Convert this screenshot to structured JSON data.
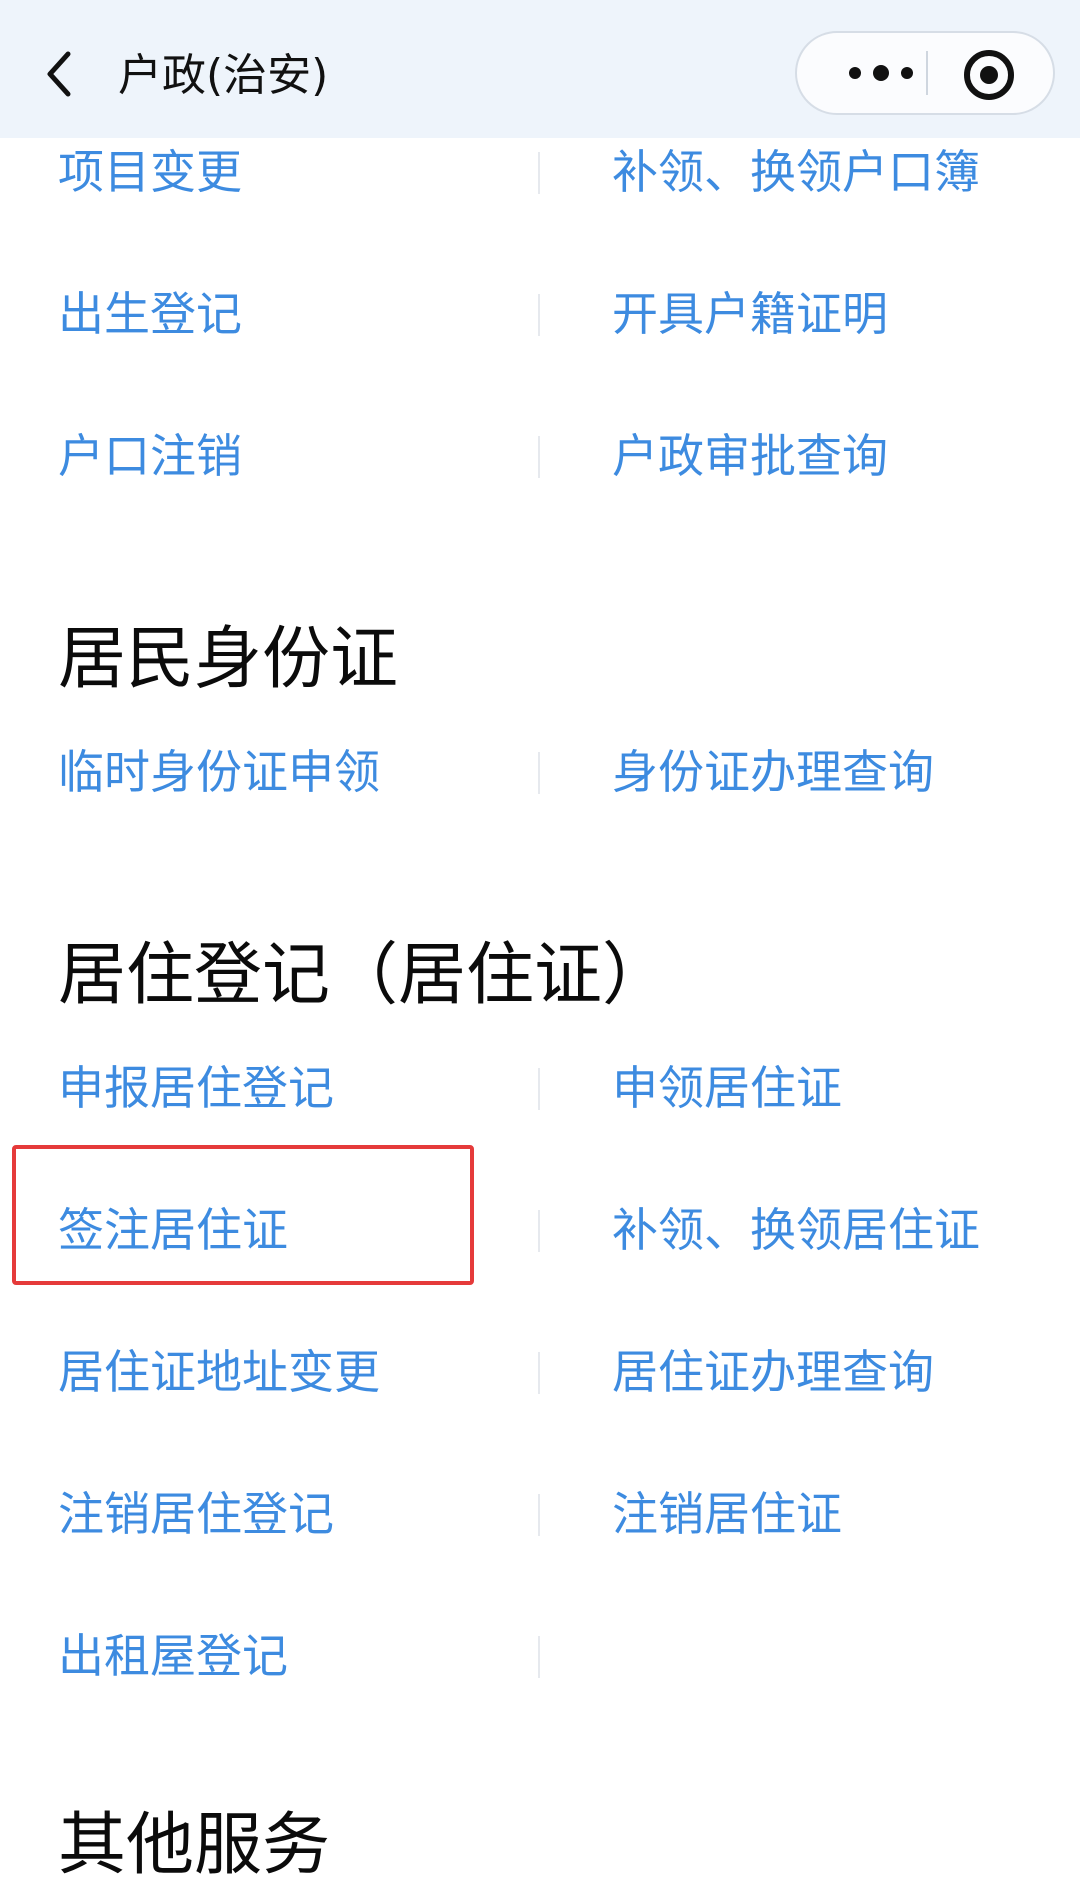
{
  "header": {
    "title": "户政(治安)",
    "back_icon": "back-chevron-icon",
    "more_icon": "more-dots-icon",
    "close_icon": "record-circle-icon"
  },
  "sections": [
    {
      "title": "",
      "items": [
        [
          "项目变更",
          "补领、换领户口簿"
        ],
        [
          "出生登记",
          "开具户籍证明"
        ],
        [
          "户口注销",
          "户政审批查询"
        ]
      ]
    },
    {
      "title": "居民身份证",
      "items": [
        [
          "临时身份证申领",
          "身份证办理查询"
        ]
      ]
    },
    {
      "title": "居住登记（居住证）",
      "items": [
        [
          "申报居住登记",
          "申领居住证"
        ],
        [
          "签注居住证",
          "补领、换领居住证"
        ],
        [
          "居住证地址变更",
          "居住证办理查询"
        ],
        [
          "注销居住登记",
          "注销居住证"
        ],
        [
          "出租屋登记",
          ""
        ]
      ]
    },
    {
      "title": "其他服务",
      "items": []
    }
  ],
  "colors": {
    "link": "#3d8be0",
    "highlight_border": "#e53a3a",
    "nav_bg": "#eef4fb"
  }
}
